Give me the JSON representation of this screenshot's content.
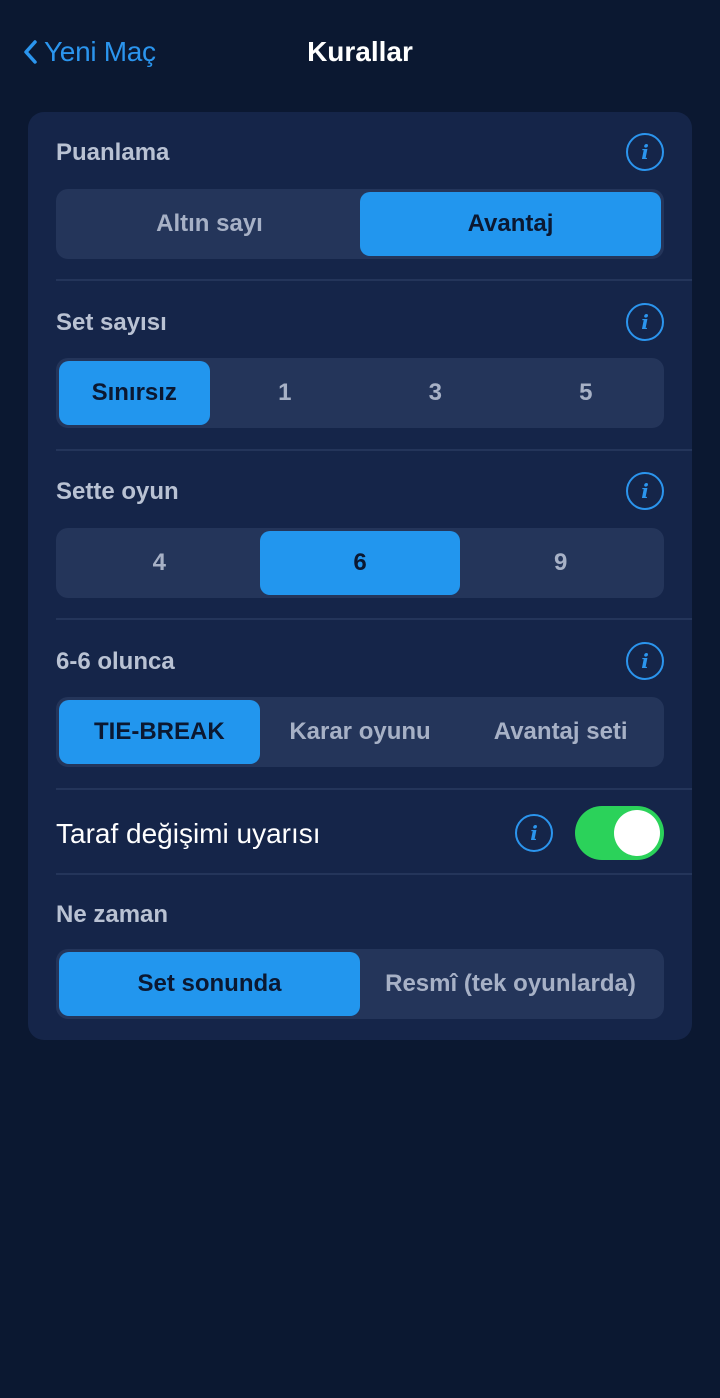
{
  "nav": {
    "back_label": "Yeni Maç",
    "title": "Kurallar"
  },
  "sections": {
    "scoring": {
      "title": "Puanlama",
      "options": [
        "Altın sayı",
        "Avantaj"
      ],
      "selected": "Avantaj"
    },
    "set_count": {
      "title": "Set sayısı",
      "options": [
        "Sınırsız",
        "1",
        "3",
        "5"
      ],
      "selected": "Sınırsız"
    },
    "games_in_set": {
      "title": "Sette oyun",
      "options": [
        "4",
        "6",
        "9"
      ],
      "selected": "6"
    },
    "tie_rule": {
      "title": "6-6 olunca",
      "options": [
        "TIE-BREAK",
        "Karar oyunu",
        "Avantaj seti"
      ],
      "selected": "TIE-BREAK"
    },
    "side_change": {
      "label": "Taraf değişimi uyarısı",
      "enabled": true
    },
    "when": {
      "title": "Ne zaman",
      "options": [
        "Set sonunda",
        "Resmî (tek oyunlarda)"
      ],
      "selected": "Set sonunda"
    }
  },
  "info_glyph": "i",
  "colors": {
    "background": "#0b1831",
    "card": "#152549",
    "segment_bg": "#24355a",
    "accent": "#2296ee",
    "toggle_on": "#2bd25a"
  }
}
